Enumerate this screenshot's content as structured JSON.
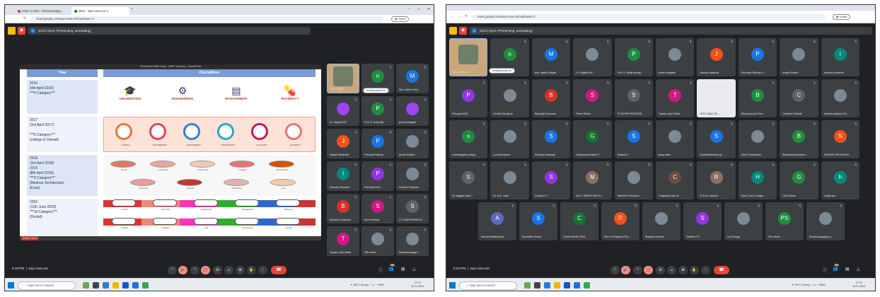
{
  "colors": {
    "meet_bg": "#202124",
    "tile_bg": "#3c4043",
    "end_call": "#ea4335",
    "slide_header": "#7a9bd3"
  },
  "left": {
    "tabs": [
      "Inbox (1,992) - kirankumargaj...",
      "Meet - wqo-cssa-ont"
    ],
    "url": "meet.google.com/wqo-cssa-ont?authuser=0",
    "guest_label": "Guest",
    "presenting": "SJCC IQAC (Presenting, annotating)",
    "ppt_title": "PowerPoint Slide Show - [NIRF Session] - PowerPoint",
    "slide": {
      "col_year": "Year",
      "col_disc": "Disciplines",
      "rows": [
        {
          "lines": [
            "2016",
            "(4th April 2016)",
            "***4 Category***"
          ],
          "labels": [
            "UNIVERSITIES",
            "ENGINEERING",
            "MANAGEMENT",
            "PHARMACY"
          ]
        },
        {
          "lines": [
            "2017",
            "(3rd April 2017)",
            "",
            "***6 Category***",
            "(college & Overall)"
          ],
          "labels": [
            "OVERALL",
            "ENGINEERING",
            "MANAGEMENT",
            "UNIVERSITIES",
            "COLLEGES",
            "PHARMACY"
          ]
        },
        {
          "lines": [
            "2018",
            "(3rd April 2018)",
            "2019",
            "(8th April 2019)",
            "***9 Category***",
            "(Medical, Architecture,",
            "&Law)"
          ],
          "labels": [
            "Overall",
            "Universities",
            "Engineering",
            "Colleges",
            "Management",
            "Pharmacy",
            "Medical",
            "Architecture",
            "Law"
          ]
        },
        {
          "lines": [
            "2020",
            "(11th June 2020)",
            "***10 Category***",
            "(Dental)"
          ],
          "labels": [
            "Overall",
            "University",
            "Engineering",
            "Management",
            "Pharmacy",
            "College",
            "Medical",
            "Law",
            "Architecture",
            "Dental"
          ]
        }
      ],
      "page_label": "SLIDE 7 OF 10"
    },
    "self_label": "SJCC IQAC",
    "newly_joined": "newlyjoseph sc",
    "tiles": [
      {
        "initial": "n",
        "name": "",
        "color": "#1e8e3e"
      },
      {
        "initial": "M",
        "name": "Mrs. Aarthi Deep...",
        "color": "#1a73e8"
      },
      {
        "initial": "",
        "name": "Dr. Sujatha NV",
        "color": "#a142f4"
      },
      {
        "initial": "P",
        "name": "Prof. R. Anita Ma...",
        "color": "#1e8e3e"
      },
      {
        "initial": "",
        "name": "preeti mangale",
        "color": "#a142f4"
      },
      {
        "initial": "J",
        "name": "Joseph Nellanatt",
        "color": "#f4511e"
      },
      {
        "initial": "P",
        "name": "Principal Patricia...",
        "color": "#1a73e8"
      },
      {
        "initial": "",
        "name": "Amali Sunitha",
        "color": "#7b8a96"
      },
      {
        "initial": "I",
        "name": "Industry Sessions",
        "color": "#00897b"
      },
      {
        "initial": "P",
        "name": "Principal MGC",
        "color": "#9334e6"
      },
      {
        "initial": "",
        "name": "Sunitha Gudipudi",
        "color": "#7b8a96"
      },
      {
        "initial": "B",
        "name": "Bikramjit Goswami",
        "color": "#d93025"
      },
      {
        "initial": "S",
        "name": "Shree Rekha",
        "color": "#d01884"
      },
      {
        "initial": "S",
        "name": "ST.JOSEPHSDEGR...",
        "color": "#5f6368"
      },
      {
        "initial": "T",
        "name": "Tapash Jyoti Kalita",
        "color": "#d01884"
      },
      {
        "initial": "",
        "name": "328 others",
        "color": "#7b8a96"
      },
      {
        "initial": "",
        "name": "Kirankumargajul...",
        "color": "#7b8a96"
      }
    ],
    "time": "5:19 PM",
    "meeting_code": "wqo-cssa-ont"
  },
  "right": {
    "url": "meet.google.com/wqo-cssa-ont?authuser=0",
    "guest_label": "Guest",
    "presenting": "SJCC IQAC (Presenting, annotating)",
    "self_label": "SJCC IQAC",
    "newly_joined": "newlyjoseph sc",
    "share_label": "SJCC IQAC (Pr...",
    "rows": [
      [
        {
          "initial": "n",
          "name": "",
          "color": "#1e8e3e"
        },
        {
          "initial": "M",
          "name": "Mrs. Aarthi Deepak",
          "color": "#1a73e8"
        },
        {
          "initial": "",
          "name": "Dr. Sujatha NV",
          "color": "#7b8a96"
        },
        {
          "initial": "P",
          "name": "Prof. R. Anita Manag...",
          "color": "#1e8e3e"
        },
        {
          "initial": "",
          "name": "preeti mangale",
          "color": "#7b8a96"
        },
        {
          "initial": "J",
          "name": "Joseph Nellanatt",
          "color": "#f4511e"
        },
        {
          "initial": "P",
          "name": "Principal Patricia​n C...",
          "color": "#1a73e8"
        },
        {
          "initial": "",
          "name": "Amali Sunitha",
          "color": "#7b8a96"
        },
        {
          "initial": "I",
          "name": "Industry Sessions",
          "color": "#00897b"
        }
      ],
      [
        {
          "initial": "P",
          "name": "Principal MGC",
          "color": "#9334e6"
        },
        {
          "initial": "",
          "name": "Sunitha Gudipudi",
          "color": "#7b8a96"
        },
        {
          "initial": "B",
          "name": "Bikramjit Goswami",
          "color": "#d93025"
        },
        {
          "initial": "S",
          "name": "Shree Rekha",
          "color": "#d01884"
        },
        {
          "initial": "S",
          "name": "ST.JOSEPHSDEGRE...",
          "color": "#5f6368"
        },
        {
          "initial": "T",
          "name": "Tapash Jyoti Kalita",
          "color": "#d01884"
        },
        {
          "initial": "B",
          "name": "Bhaswati Jyoti Gos...",
          "color": "#1e8e3e"
        },
        {
          "initial": "C",
          "name": "Christina Delphin",
          "color": "#5f6368"
        },
        {
          "initial": "",
          "name": "Anantha lakshmi Pa...",
          "color": "#7b8a96"
        }
      ],
      [
        {
          "initial": "s",
          "name": "subhrangshu purkay...",
          "color": "#1e8e3e"
        },
        {
          "initial": "",
          "name": "Loretta Alvarez",
          "color": "#7b8a96"
        },
        {
          "initial": "S",
          "name": "Sukanya Kashyap",
          "color": "#1a73e8"
        },
        {
          "initial": "G",
          "name": "Gaikulung Andrew P...",
          "color": "#137333"
        },
        {
          "initial": "S",
          "name": "Swapna T",
          "color": "#1a73e8"
        },
        {
          "initial": "",
          "name": "jessy sabu",
          "color": "#7b8a96"
        },
        {
          "initial": "S",
          "name": "SudhakarReddy sjc",
          "color": "#1a73e8"
        },
        {
          "initial": "",
          "name": "Alice Thermadam",
          "color": "#7b8a96"
        },
        {
          "initial": "B",
          "name": "Bhavanikrishnavenu...",
          "color": "#1e8e3e"
        },
        {
          "initial": "S",
          "name": "SHAYNE REYNOLDS",
          "color": "#f4511e"
        }
      ],
      [
        {
          "initial": "S",
          "name": "Dr Sagaya Mary T",
          "color": "#5f6368"
        },
        {
          "initial": "",
          "name": "Dr. M.K. Jose",
          "color": "#7b8a96"
        },
        {
          "initial": "S",
          "name": "Sanaja D V",
          "color": "#9334e6"
        },
        {
          "initial": "M",
          "name": "MS.V. DEEPA SWITH...",
          "color": "#8d6e63"
        },
        {
          "initial": "",
          "name": "Mieslirho Francisca",
          "color": "#7b8a96"
        },
        {
          "initial": "C",
          "name": "Chayanika Sarma",
          "color": "#6d4c41"
        },
        {
          "initial": "R",
          "name": "R.Sree Lakshmi",
          "color": "#8d6e63"
        },
        {
          "initial": "H",
          "name": "Holy Cross College ...",
          "color": "#00897b"
        },
        {
          "initial": "G",
          "name": "Glen Dsilva",
          "color": "#1e8e3e"
        },
        {
          "initial": "h",
          "name": "harsjit das",
          "color": "#00897b"
        }
      ],
      [
        {
          "initial": "A",
          "name": "Ashwini Madhikunta",
          "color": "#5c6bc0"
        },
        {
          "initial": "S",
          "name": "Sumedha Verma",
          "color": "#1a73e8"
        },
        {
          "initial": "C",
          "name": "Carmel NAAC 2022",
          "color": "#137333"
        },
        {
          "initial": "R",
          "name": "Rev. Fr Prakash D'Su...",
          "color": "#f4511e"
        },
        {
          "initial": "",
          "name": "Bhaskar Sharma",
          "color": "#7b8a96"
        },
        {
          "initial": "S",
          "name": "Savitha K S",
          "color": "#9334e6"
        },
        {
          "initial": "",
          "name": "Lal Omega",
          "color": "#7b8a96"
        },
        {
          "initial": "PS",
          "name": "312 others",
          "color": "#1e8e3e"
        },
        {
          "initial": "",
          "name": "Kirankumargajule g",
          "color": "#7b8a96"
        }
      ]
    ],
    "time": "5:23 PM",
    "meeting_code": "wqo-cssa-ont"
  },
  "taskbar": {
    "search_placeholder": "Type here to search",
    "weather": "28°C Sunny",
    "lang": "ENG",
    "clock_left": [
      "17:19",
      "15-11-2024"
    ],
    "clock_right": [
      "17:23",
      "15-11-2024"
    ]
  },
  "meet_badge": "356"
}
